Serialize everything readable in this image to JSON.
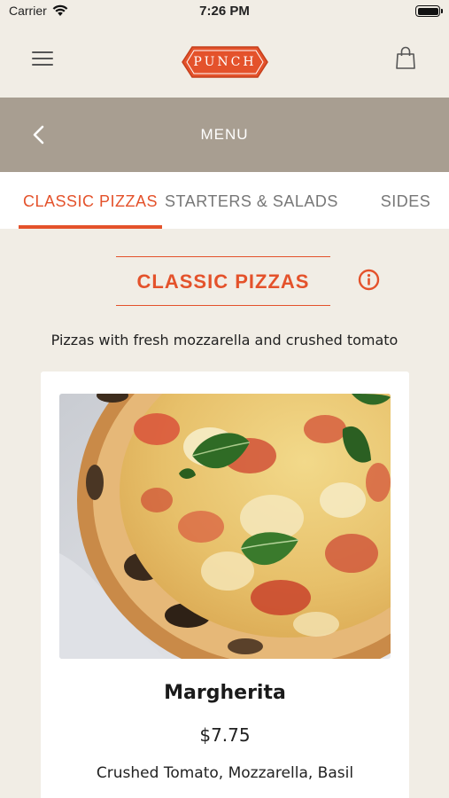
{
  "status_bar": {
    "carrier": "Carrier",
    "time": "7:26 PM"
  },
  "header": {
    "logo_text": "PUNCH",
    "brand_color": "#e4522b"
  },
  "menu_bar": {
    "title": "MENU"
  },
  "tabs": [
    {
      "label": "CLASSIC PIZZAS",
      "active": true
    },
    {
      "label": "STARTERS & SALADS",
      "active": false
    },
    {
      "label": "SIDES",
      "active": false
    }
  ],
  "section": {
    "title": "CLASSIC PIZZAS",
    "description": "Pizzas with fresh mozzarella and crushed tomato"
  },
  "items": [
    {
      "name": "Margherita",
      "price": "$7.75",
      "description": "Crushed Tomato, Mozzarella, Basil"
    }
  ]
}
